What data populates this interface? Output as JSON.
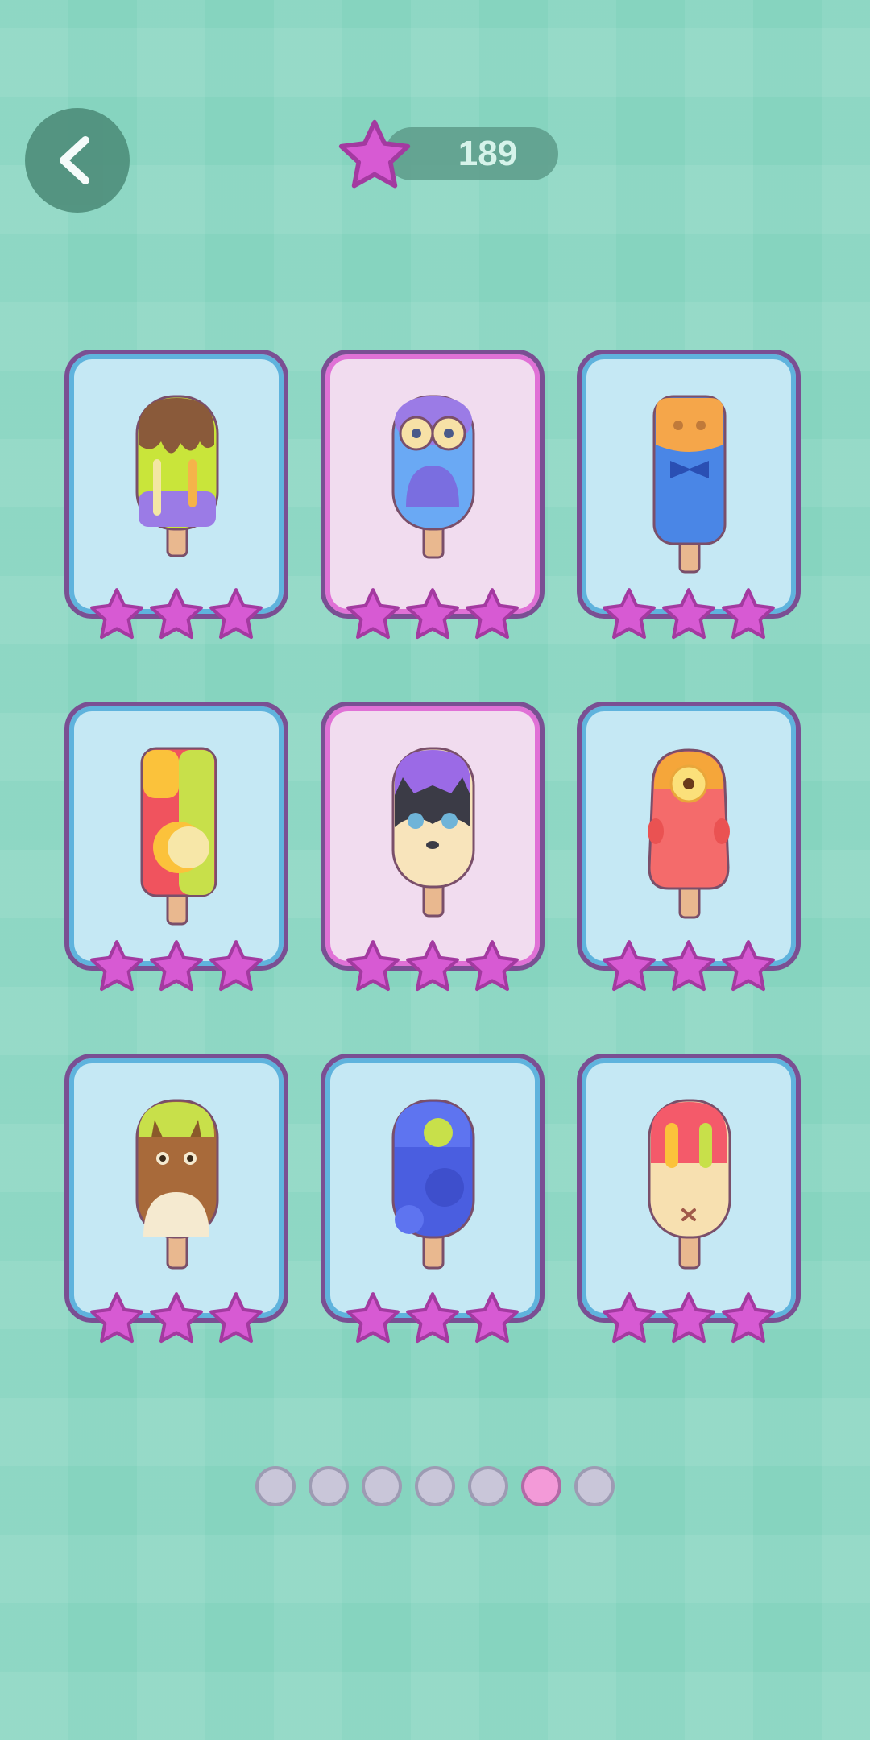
{
  "header": {
    "back_icon": "chevron-left-icon",
    "star_count": "189",
    "star_icon": "star-icon",
    "colors": {
      "star": "#d75ad3",
      "star_outline": "#a33aa0"
    }
  },
  "levels": [
    {
      "name": "chocolate-drip-popsicle",
      "style": "blue",
      "stars_earned": 3
    },
    {
      "name": "blue-monster-popsicle",
      "style": "pink",
      "stars_earned": 3
    },
    {
      "name": "bowtie-suit-popsicle",
      "style": "blue",
      "stars_earned": 3
    },
    {
      "name": "fruit-slice-popsicle",
      "style": "blue",
      "stars_earned": 3
    },
    {
      "name": "husky-dog-popsicle",
      "style": "pink",
      "stars_earned": 3
    },
    {
      "name": "one-eyed-alien-popsicle",
      "style": "blue",
      "stars_earned": 3
    },
    {
      "name": "forest-spirit-popsicle",
      "style": "blue",
      "stars_earned": 3
    },
    {
      "name": "night-sky-popsicle",
      "style": "blue",
      "stars_earned": 3
    },
    {
      "name": "bunny-popsicle",
      "style": "blue",
      "stars_earned": 3
    }
  ],
  "pagination": {
    "total_pages": 7,
    "current_page": 6
  }
}
